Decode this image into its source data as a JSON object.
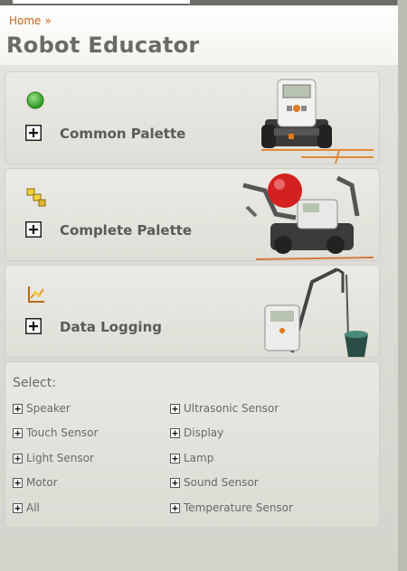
{
  "breadcrumb": {
    "home": "Home",
    "separator": "»"
  },
  "page": {
    "title": "Robot Educator"
  },
  "palettes": [
    {
      "label": "Common Palette",
      "icon": "green-circle-icon"
    },
    {
      "label": "Complete Palette",
      "icon": "yellow-blocks-icon"
    },
    {
      "label": "Data Logging",
      "icon": "data-logging-icon"
    }
  ],
  "select": {
    "title": "Select:",
    "left": [
      "Speaker",
      "Touch Sensor",
      "Light Sensor",
      "Motor",
      "All"
    ],
    "right": [
      "Ultrasonic Sensor",
      "Display",
      "Lamp",
      "Sound Sensor",
      "Temperature Sensor"
    ]
  },
  "colors": {
    "accent": "#c9651d",
    "background": "#d7d6cf",
    "text": "#6a6a66"
  }
}
